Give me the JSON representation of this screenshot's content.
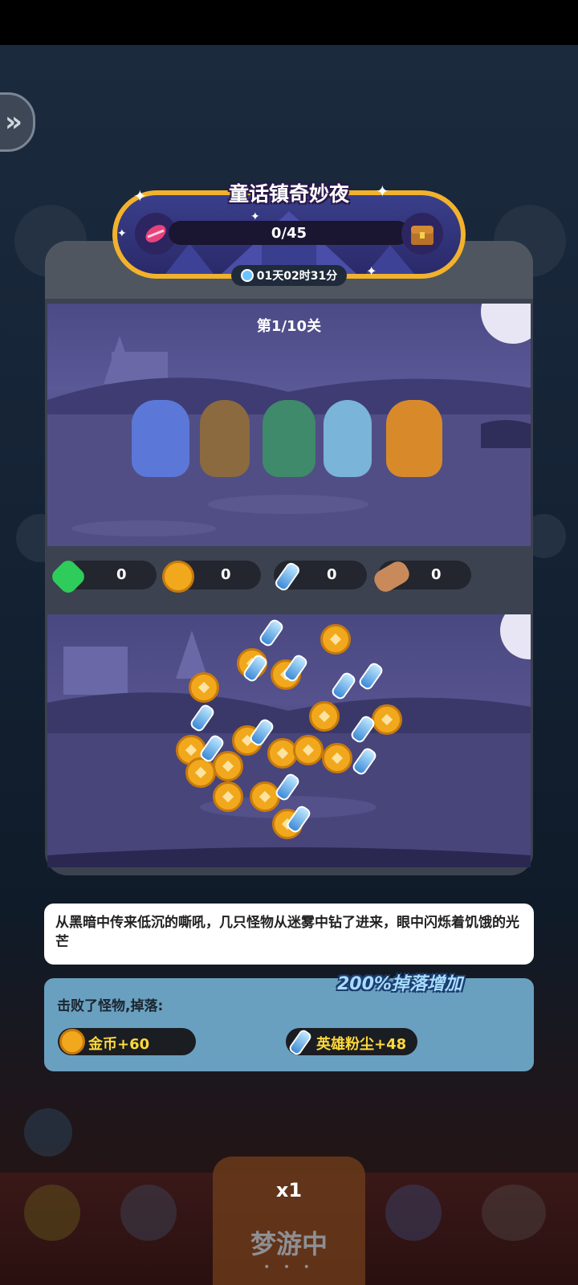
{
  "event": {
    "title": "童话镇奇妙夜",
    "progress": "0/45",
    "timer": "01天02时31分"
  },
  "battle": {
    "stage": "第1/10关"
  },
  "resources": [
    {
      "icon": "gem-icon",
      "value": "0"
    },
    {
      "icon": "coin-icon",
      "value": "0"
    },
    {
      "icon": "hero-dust-icon",
      "value": "0"
    },
    {
      "icon": "wood-log-icon",
      "value": "0"
    }
  ],
  "story": {
    "text": "从黑暗中传来低沉的嘶吼，几只怪物从迷雾中钻了进来，眼中闪烁着饥饿的光芒"
  },
  "reward": {
    "title": "击败了怪物,掉落:",
    "bonus": "200%掉落增加",
    "items": [
      {
        "icon": "coin-icon",
        "label": "金币+60"
      },
      {
        "icon": "hero-dust-icon",
        "label": "英雄粉尘+48"
      }
    ]
  },
  "bottom": {
    "multiplier": "x1",
    "status": "梦游中",
    "more": "• • •"
  },
  "colors": {
    "gold": "#f2b22c",
    "panel": "#3c4250",
    "reward_bg": "#6aa0bf",
    "bonus_text": "#a7dcff"
  }
}
